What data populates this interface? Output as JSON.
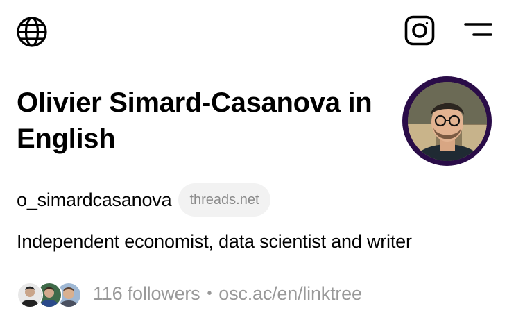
{
  "header": {
    "language_icon": "globe-icon",
    "instagram_icon": "instagram-icon",
    "menu_icon": "menu-icon"
  },
  "profile": {
    "name": "Olivier Simard-Casanova in English",
    "handle": "o_simardcasanova",
    "domain": "threads.net",
    "bio": "Independent economist, data scientist and writer",
    "followers": "116 followers",
    "separator": "•",
    "link": "osc.ac/en/linktree"
  },
  "colors": {
    "avatar_ring": "#2a0c48",
    "muted_text": "#999999",
    "pill_bg": "#f2f2f2"
  }
}
